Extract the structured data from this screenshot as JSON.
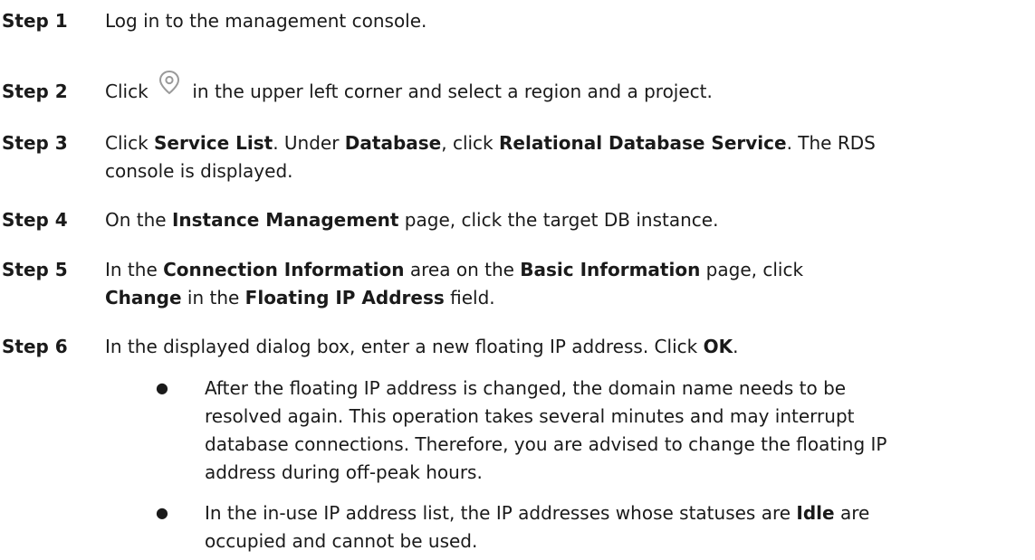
{
  "steps": [
    {
      "label": "Step 1",
      "parts": [
        "Log in to the management console."
      ]
    },
    {
      "label": "Step 2",
      "parts": [
        "Click",
        "in the upper left corner and select a region and a project."
      ],
      "icon": "location-pin-icon"
    },
    {
      "label": "Step 3",
      "line1": [
        "Click ",
        "Service List",
        ". Under ",
        "Database",
        ", click ",
        "Relational Database Service",
        ". The RDS"
      ],
      "line2": "console is displayed."
    },
    {
      "label": "Step 4",
      "parts": [
        "On the ",
        "Instance Management",
        " page, click the target DB instance."
      ]
    },
    {
      "label": "Step 5",
      "line1": [
        "In the ",
        "Connection Information",
        " area on the ",
        "Basic Information",
        " page, click"
      ],
      "line2": [
        "Change",
        " in the ",
        "Floating IP Address",
        " field."
      ]
    },
    {
      "label": "Step 6",
      "parts": [
        "In the displayed dialog box, enter a new floating IP address. Click ",
        "OK",
        "."
      ]
    }
  ],
  "bullets": [
    {
      "symbol": "●",
      "lines": [
        "After the floating IP address is changed, the domain name needs to be",
        "resolved again. This operation takes several minutes and may interrupt",
        "database connections. Therefore, you are advised to change the floating IP",
        "address during off-peak hours."
      ]
    },
    {
      "symbol": "●",
      "line1": [
        "In the in-use IP address list, the IP addresses whose statuses are ",
        "Idle",
        " are"
      ],
      "line2": "occupied and cannot be used."
    }
  ]
}
